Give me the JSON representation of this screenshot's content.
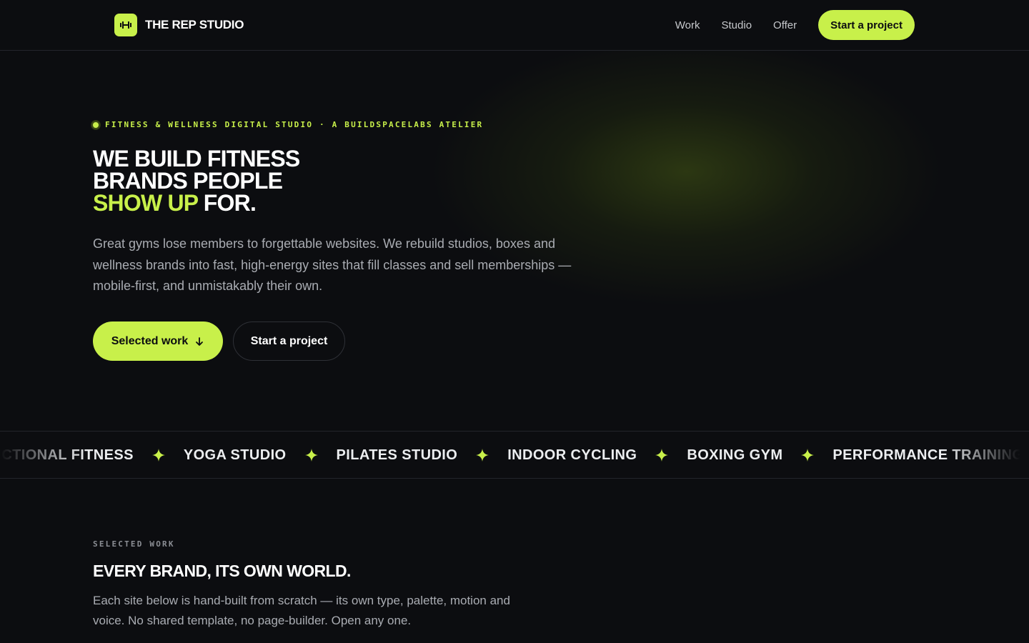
{
  "colors": {
    "accent": "#c8f04a",
    "background": "#0c0d10",
    "border": "#23252b"
  },
  "header": {
    "logo_icon": "dumbbell-icon",
    "brand": "THE REP STUDIO",
    "nav": [
      {
        "label": "Work"
      },
      {
        "label": "Studio"
      },
      {
        "label": "Offer"
      }
    ],
    "cta_label": "Start a project"
  },
  "hero": {
    "eyebrow": "FITNESS & WELLNESS DIGITAL STUDIO · A BUILDSPACELABS ATELIER",
    "title_line1": "WE BUILD FITNESS",
    "title_line2": "BRANDS PEOPLE",
    "title_accent": "SHOW UP",
    "title_end": " FOR.",
    "subtitle": "Great gyms lose members to forgettable websites. We rebuild studios, boxes and wellness brands into fast, high-energy sites that fill classes and sell memberships — mobile-first, and unmistakably their own.",
    "primary_button": "Selected work",
    "primary_icon": "arrow-down-icon",
    "secondary_button": "Start a project"
  },
  "marquee": {
    "items": [
      "FUNCTIONAL FITNESS",
      "YOGA STUDIO",
      "PILATES STUDIO",
      "INDOOR CYCLING",
      "BOXING GYM",
      "PERFORMANCE TRAINING"
    ],
    "separator_icon": "sparkle-star-icon"
  },
  "selected_work": {
    "label": "SELECTED WORK",
    "title": "EVERY BRAND, ITS OWN WORLD.",
    "subtitle": "Each site below is hand-built from scratch — its own type, palette, motion and voice. No shared template, no page-builder. Open any one."
  }
}
